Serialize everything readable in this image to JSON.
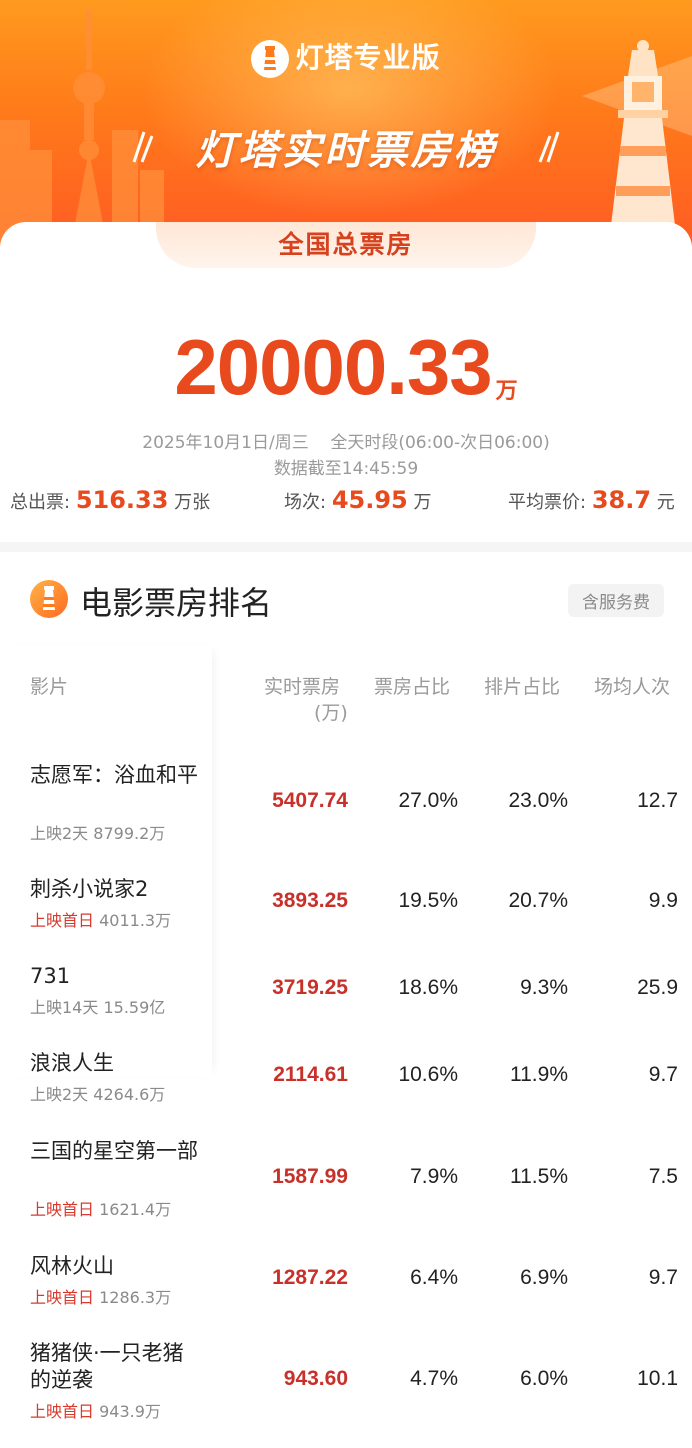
{
  "brand": {
    "name": "灯塔专业版"
  },
  "banner": {
    "title": "灯塔实时票房榜"
  },
  "summary": {
    "tab": "全国总票房",
    "total": "20000.33",
    "total_unit": "万",
    "date_range": "2025年10月1日/周三    全天时段(06:00-次日06:00)",
    "updated": "数据截至14:45:59",
    "tickets": {
      "label": "总出票:",
      "value": "516.33",
      "unit": "万张"
    },
    "shows": {
      "label": "场次:",
      "value": "45.95",
      "unit": "万"
    },
    "avg_price": {
      "label": "平均票价:",
      "value": "38.7",
      "unit": "元"
    }
  },
  "ranking": {
    "title": "电影票房排名",
    "badge": "含服务费",
    "headers": {
      "film": "影片",
      "gross_line1": "实时票房",
      "gross_line2": "(万)",
      "share": "票房占比",
      "screening": "排片占比",
      "per_show": "场均人次"
    },
    "rows": [
      {
        "name": "志愿军：浴血和平",
        "status": "上映2天",
        "status_new": false,
        "cumulative": "8799.2万",
        "gross": "5407.74",
        "share": "27.0%",
        "screening": "23.0%",
        "per_show": "12.7"
      },
      {
        "name": "刺杀小说家2",
        "status": "上映首日",
        "status_new": true,
        "cumulative": "4011.3万",
        "gross": "3893.25",
        "share": "19.5%",
        "screening": "20.7%",
        "per_show": "9.9"
      },
      {
        "name": "731",
        "status": "上映14天",
        "status_new": false,
        "cumulative": "15.59亿",
        "gross": "3719.25",
        "share": "18.6%",
        "screening": "9.3%",
        "per_show": "25.9"
      },
      {
        "name": "浪浪人生",
        "status": "上映2天",
        "status_new": false,
        "cumulative": "4264.6万",
        "gross": "2114.61",
        "share": "10.6%",
        "screening": "11.9%",
        "per_show": "9.7"
      },
      {
        "name": "三国的星空第一部",
        "status": "上映首日",
        "status_new": true,
        "cumulative": "1621.4万",
        "gross": "1587.99",
        "share": "7.9%",
        "screening": "11.5%",
        "per_show": "7.5"
      },
      {
        "name": "风林火山",
        "status": "上映首日",
        "status_new": true,
        "cumulative": "1286.3万",
        "gross": "1287.22",
        "share": "6.4%",
        "screening": "6.9%",
        "per_show": "9.7"
      },
      {
        "name": "猪猪侠·一只老猪的逆袭",
        "status": "上映首日",
        "status_new": true,
        "cumulative": "943.9万",
        "gross": "943.60",
        "share": "4.7%",
        "screening": "6.0%",
        "per_show": "10.1"
      }
    ]
  },
  "colors": {
    "accent": "#e84a1e",
    "gross": "#c8302a",
    "new_release": "#d93a2e",
    "banner": "#ff7a1a"
  },
  "icons": [
    "lighthouse-logo-icon",
    "lighthouse-small-icon"
  ]
}
